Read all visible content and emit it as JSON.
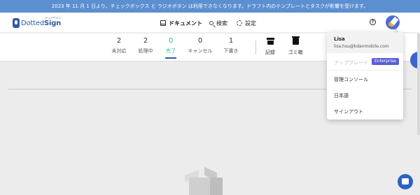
{
  "banner": {
    "text": "2023 年 11 月 1 日より、チェックボックス と ラジオボタン は利用できなくなります。ドラフト内のテンプレートとタスクが影響を受けます。"
  },
  "header": {
    "logo_light": "Dotted",
    "logo_bold": "Sign",
    "logo_sub": "ドットサイン",
    "nav": {
      "documents": "ドキュメント",
      "search": "検索",
      "settings": "設定"
    },
    "help_icon": "?"
  },
  "stats": [
    {
      "count": "2",
      "label": "未対応"
    },
    {
      "count": "2",
      "label": "処理中"
    },
    {
      "count": "0",
      "label": "完了"
    },
    {
      "count": "0",
      "label": "キャンセル"
    },
    {
      "count": "1",
      "label": "下書き"
    }
  ],
  "actions": {
    "archive": "記録",
    "trash": "ゴミ箱"
  },
  "active_tab": "完了",
  "user_menu": {
    "name": "Lisa",
    "email": "lisa.hsu@kdanmobile.com",
    "upgrade": "アップグレード",
    "plan_badge": "Enterprise",
    "admin_console": "管理コンソール",
    "language": "日本語",
    "sign_out": "サインアウト"
  },
  "colors": {
    "banner": "#5b8fd0",
    "accent_teal": "#2eb8a3",
    "brand_blue": "#2e5aa5",
    "badge": "#5b5fd4"
  },
  "icons": [
    "document-icon",
    "search-icon",
    "gear-icon",
    "help-icon",
    "avatar",
    "archive-icon",
    "trash-icon",
    "chat-icon",
    "empty-box-illustration"
  ]
}
